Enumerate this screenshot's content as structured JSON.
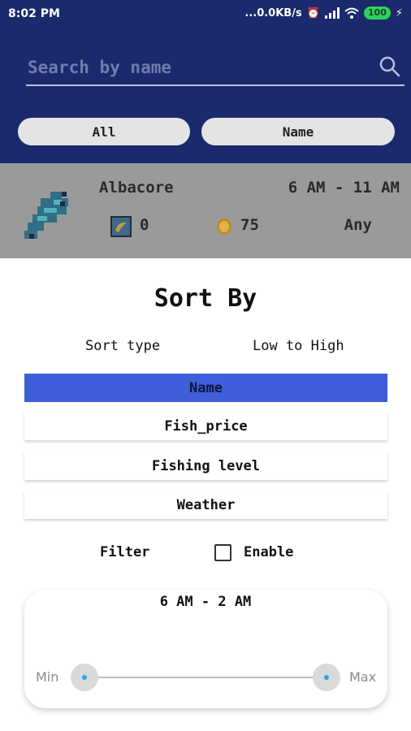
{
  "status_bar": {
    "time": "8:02 PM",
    "network_speed": "...0.0KB/s",
    "battery": "100"
  },
  "search": {
    "placeholder": "Search by name",
    "value": ""
  },
  "chips": {
    "all_label": "All",
    "sort_label": "Name"
  },
  "fish_item": {
    "name": "Albacore",
    "time_range": "6 AM - 11 AM",
    "bait_count": "0",
    "price": "75",
    "weather": "Any"
  },
  "sort_sheet": {
    "title": "Sort By",
    "sort_type_label": "Sort type",
    "sort_order": "Low to High",
    "options": [
      {
        "label": "Name",
        "selected": true
      },
      {
        "label": "Fish_price",
        "selected": false
      },
      {
        "label": "Fishing level",
        "selected": false
      },
      {
        "label": "Weather",
        "selected": false
      }
    ],
    "filter_label": "Filter",
    "enable_label": "Enable",
    "enable_checked": false,
    "range_value": "6 AM - 2 AM",
    "slider_min_label": "Min",
    "slider_max_label": "Max"
  },
  "colors": {
    "header_bg": "#1b2a6c",
    "selected_option": "#3f5ed9",
    "slider_dot": "#2aa4e8"
  }
}
